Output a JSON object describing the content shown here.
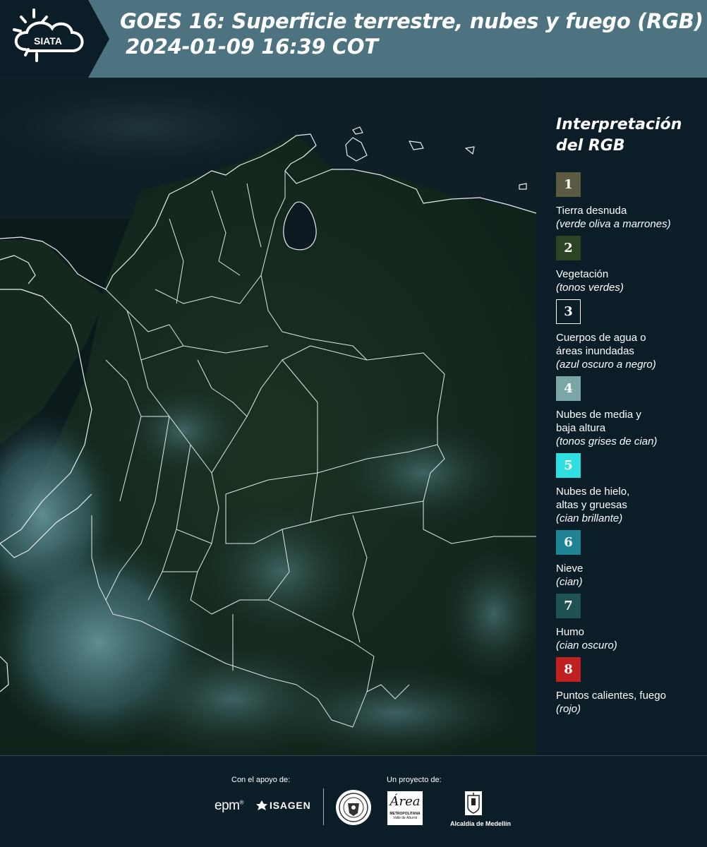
{
  "header": {
    "logo_text": "SIATA",
    "title_line1": "GOES 16: Superficie terrestre, nubes y fuego (RGB)",
    "title_line2": "2024-01-09 16:39 COT"
  },
  "legend": {
    "title_line1": "Interpretación",
    "title_line2": "del RGB",
    "items": [
      {
        "number": "1",
        "color": "#5b5a42",
        "label": "Tierra desnuda",
        "desc": "(verde oliva a marrones)"
      },
      {
        "number": "2",
        "color": "#2d4424",
        "label": "Vegetación",
        "desc": "(tonos verdes)"
      },
      {
        "number": "3",
        "color": "#0b1d26",
        "label": "Cuerpos de agua o áreas inundadas",
        "desc": "(azul oscuro a negro)"
      },
      {
        "number": "4",
        "color": "#7aa6a6",
        "label": "Nubes de media y baja altura",
        "desc": "(tonos grises de cian)"
      },
      {
        "number": "5",
        "color": "#2fdede",
        "label": "Nubes de hielo, altas y gruesas",
        "desc": "(cian brillante)"
      },
      {
        "number": "6",
        "color": "#1f8396",
        "label": "Nieve",
        "desc": "(cian)"
      },
      {
        "number": "7",
        "color": "#1f5253",
        "label": "Humo",
        "desc": "(cian oscuro)"
      },
      {
        "number": "8",
        "color": "#c0201f",
        "label": "Puntos calientes, fuego",
        "desc": "(rojo)"
      }
    ]
  },
  "footer": {
    "support_label": "Con el apoyo de:",
    "project_label": "Un proyecto de:",
    "epm": "epm",
    "isagen": "ISAGEN",
    "area_text": "Área",
    "area_sub1": "METROPOLITANA",
    "area_sub2": "Valle de Aburrá",
    "alcaldia": "Alcaldía de Medellín"
  }
}
